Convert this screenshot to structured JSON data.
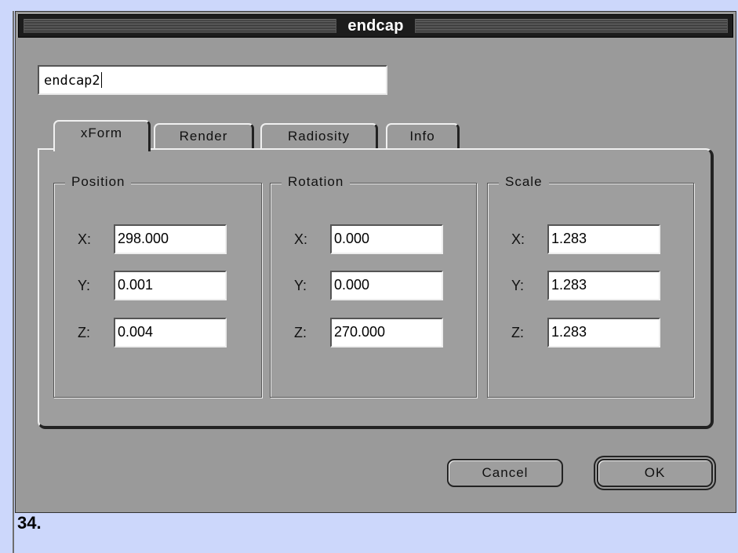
{
  "window": {
    "title": "endcap"
  },
  "name_field": {
    "value": "endcap2"
  },
  "tabs": [
    {
      "label": "xForm",
      "active": true
    },
    {
      "label": "Render",
      "active": false
    },
    {
      "label": "Radiosity",
      "active": false
    },
    {
      "label": "Info",
      "active": false
    }
  ],
  "groups": {
    "position": {
      "label": "Position",
      "x": "298.000",
      "y": "0.001",
      "z": "0.004"
    },
    "rotation": {
      "label": "Rotation",
      "x": "0.000",
      "y": "0.000",
      "z": "270.000"
    },
    "scale": {
      "label": "Scale",
      "x": "1.283",
      "y": "1.283",
      "z": "1.283"
    }
  },
  "axis_labels": {
    "x": "X:",
    "y": "Y:",
    "z": "Z:"
  },
  "buttons": {
    "cancel": "Cancel",
    "ok": "OK"
  },
  "caption": "34."
}
